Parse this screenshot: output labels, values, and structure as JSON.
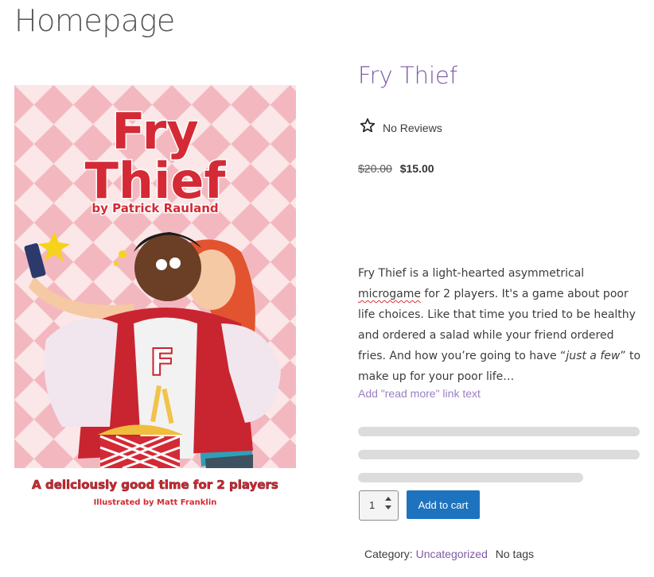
{
  "page": {
    "title": "Homepage"
  },
  "product": {
    "title": "Fry Thief",
    "rating_label": "No Reviews",
    "price_old": "$20.00",
    "price_new": "$15.00",
    "description_parts": [
      " Fry Thief is a light-hearted asymmetrical ",
      "microgame",
      " for 2 players. It's a game about poor life choices. Like that time you tried to be healthy and ordered a salad while your friend ordered fries. And how you’re going to have “",
      "just a few",
      "” to make up for your poor life…"
    ],
    "read_more": "Add \"read more\" link text",
    "quantity": "1",
    "add_to_cart_label": "Add to cart",
    "category_label": "Category:",
    "category_value": "Uncategorized",
    "tags_label": "No tags",
    "cover": {
      "title_line1": "Fry",
      "title_line2": "Thief",
      "byline": "by Patrick Rauland",
      "tagline": "A deliciously good time for 2 players",
      "illustrator": "Illustrated by Matt Franklin"
    }
  },
  "colors": {
    "accent": "#7d5aa6",
    "button": "#1e73be",
    "cover_red": "#d42a35"
  }
}
